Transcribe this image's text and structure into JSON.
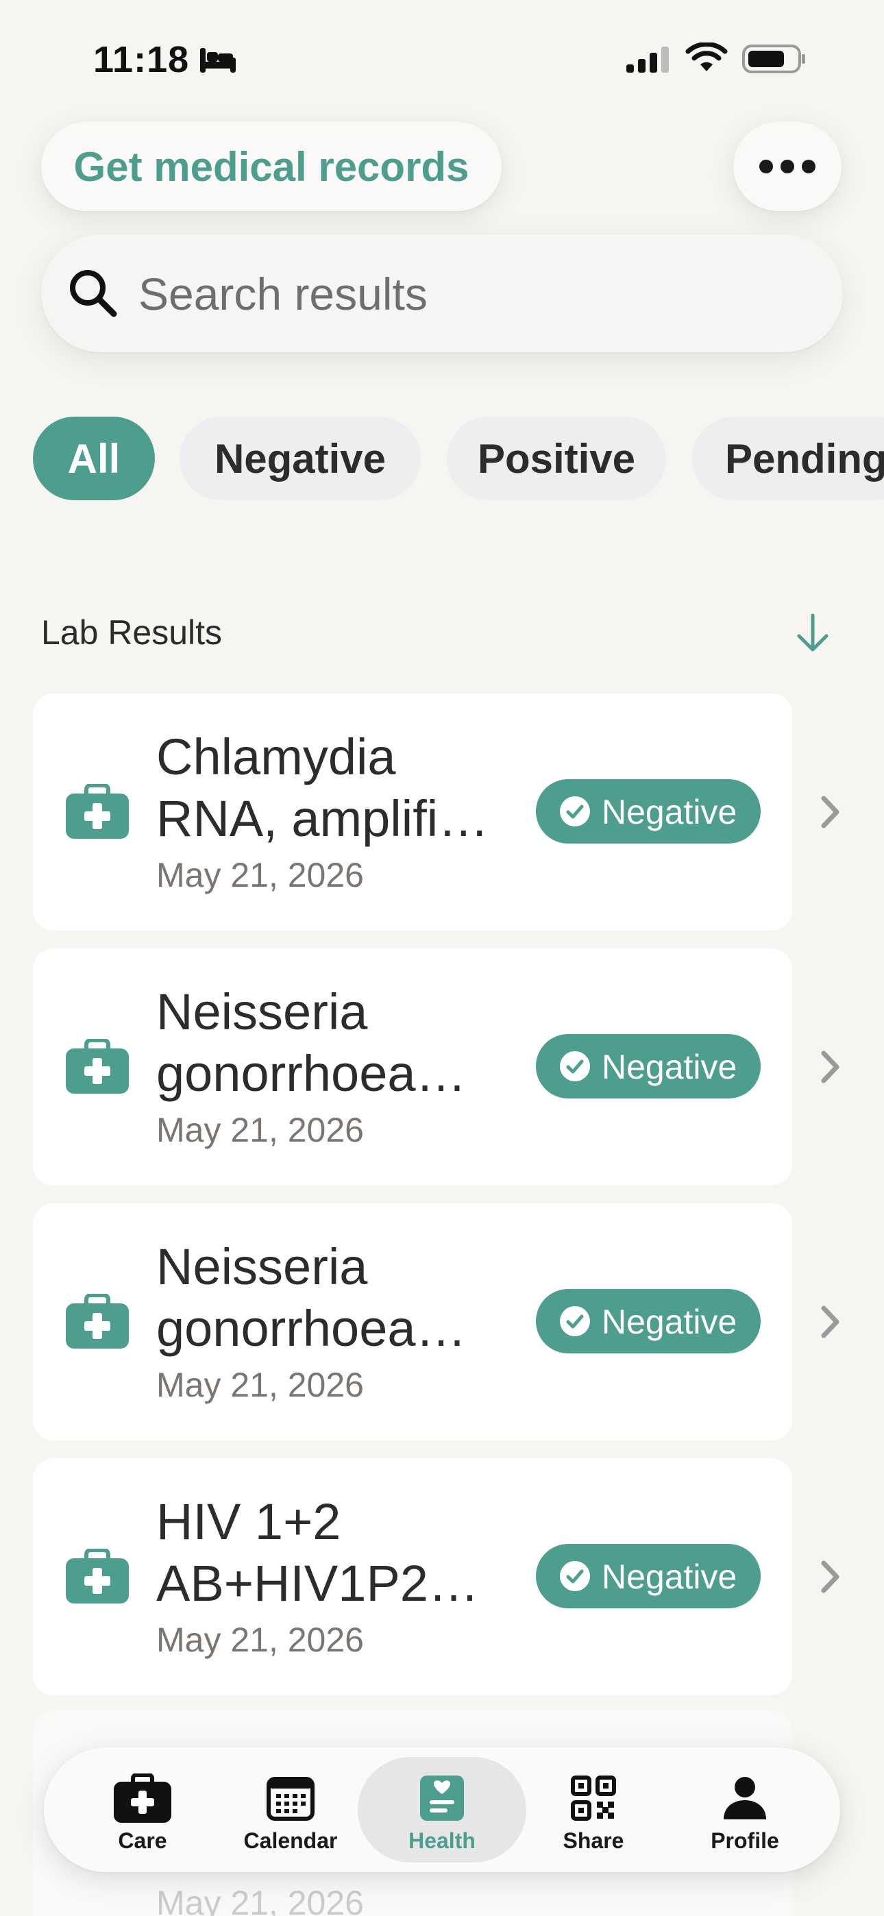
{
  "status_bar": {
    "time": "11:18",
    "icons": [
      "sleep-focus-icon",
      "cellular-signal-icon",
      "wifi-icon",
      "battery-icon"
    ]
  },
  "header": {
    "records_button_label": "Get medical records",
    "more_button_icon": "ellipsis-icon"
  },
  "search": {
    "placeholder": "Search results",
    "value": ""
  },
  "filters": {
    "chips": [
      "All",
      "Negative",
      "Positive",
      "Pending"
    ],
    "selected": "All"
  },
  "section": {
    "title": "Lab Results",
    "sort_icon": "arrow-down-icon"
  },
  "results": [
    {
      "title_line1": "Chlamydia",
      "title_line2": "RNA, amplifi…",
      "date": "May 21, 2026",
      "status": "Negative"
    },
    {
      "title_line1": "Neisseria",
      "title_line2": "gonorrhoea…",
      "date": "May 21, 2026",
      "status": "Negative"
    },
    {
      "title_line1": "Neisseria",
      "title_line2": "gonorrhoea…",
      "date": "May 21, 2026",
      "status": "Negative"
    },
    {
      "title_line1": "HIV 1+2",
      "title_line2": "AB+HIV1P2…",
      "date": "May 21, 2026",
      "status": "Negative"
    }
  ],
  "partial_result": {
    "date": "May 21, 2026"
  },
  "tab_bar": {
    "tabs": [
      {
        "label": "Care",
        "icon": "medical-kit-icon"
      },
      {
        "label": "Calendar",
        "icon": "calendar-icon"
      },
      {
        "label": "Health",
        "icon": "health-record-icon"
      },
      {
        "label": "Share",
        "icon": "qr-code-icon"
      },
      {
        "label": "Profile",
        "icon": "person-icon"
      }
    ],
    "active": "Health"
  },
  "colors": {
    "accent": "#4e9e8f",
    "background": "#f7f5f2",
    "chip_inactive": "#eeedf0",
    "card": "#ffffff",
    "date_text": "#7a7570"
  }
}
